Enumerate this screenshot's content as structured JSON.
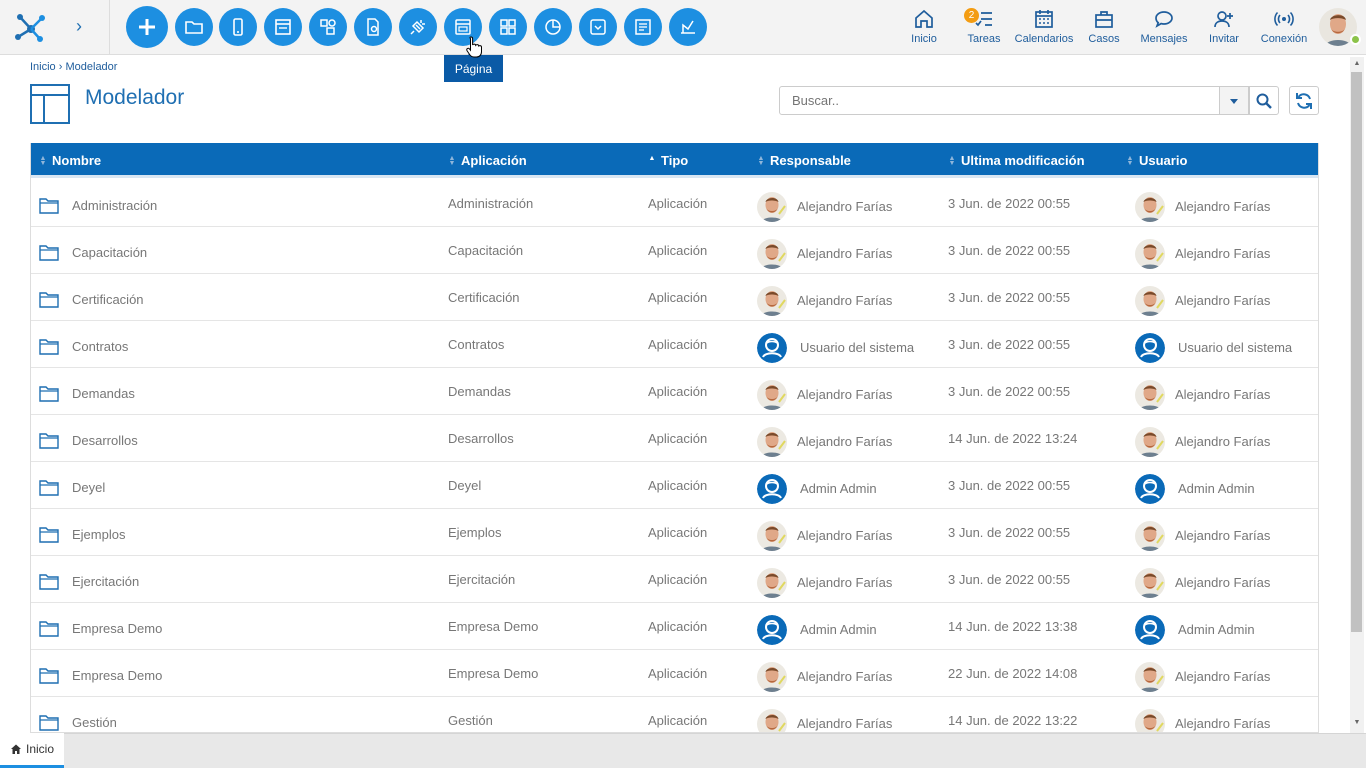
{
  "app": {
    "tooltip": "Página"
  },
  "nav": [
    {
      "label": "Inicio",
      "icon": "home-icon"
    },
    {
      "label": "Tareas",
      "icon": "tasks-icon",
      "badge": "2"
    },
    {
      "label": "Calendarios",
      "icon": "calendar-icon"
    },
    {
      "label": "Casos",
      "icon": "briefcase-icon"
    },
    {
      "label": "Mensajes",
      "icon": "chat-icon"
    },
    {
      "label": "Invitar",
      "icon": "invite-user-icon"
    },
    {
      "label": "Conexión",
      "icon": "connection-icon"
    }
  ],
  "breadcrumb": {
    "home": "Inicio",
    "separator": "›",
    "current": "Modelador"
  },
  "page": {
    "title": "Modelador"
  },
  "search": {
    "placeholder": "Buscar.."
  },
  "table": {
    "columns": [
      "Nombre",
      "Aplicación",
      "Tipo",
      "Responsable",
      "Ultima modificación",
      "Usuario"
    ],
    "rows": [
      {
        "nombre": "Administración",
        "aplicacion": "Administración",
        "tipo": "Aplicación",
        "responsable": "Alejandro Farías",
        "resp_avatar": "photo",
        "modificacion": "3 Jun. de 2022 00:55",
        "usuario": "Alejandro Farías",
        "user_avatar": "photo"
      },
      {
        "nombre": "Capacitación",
        "aplicacion": "Capacitación",
        "tipo": "Aplicación",
        "responsable": "Alejandro Farías",
        "resp_avatar": "photo",
        "modificacion": "3 Jun. de 2022 00:55",
        "usuario": "Alejandro Farías",
        "user_avatar": "photo"
      },
      {
        "nombre": "Certificación",
        "aplicacion": "Certificación",
        "tipo": "Aplicación",
        "responsable": "Alejandro Farías",
        "resp_avatar": "photo",
        "modificacion": "3 Jun. de 2022 00:55",
        "usuario": "Alejandro Farías",
        "user_avatar": "photo"
      },
      {
        "nombre": "Contratos",
        "aplicacion": "Contratos",
        "tipo": "Aplicación",
        "responsable": "Usuario del sistema",
        "resp_avatar": "system",
        "modificacion": "3 Jun. de 2022 00:55",
        "usuario": "Usuario del sistema",
        "user_avatar": "system"
      },
      {
        "nombre": "Demandas",
        "aplicacion": "Demandas",
        "tipo": "Aplicación",
        "responsable": "Alejandro Farías",
        "resp_avatar": "photo",
        "modificacion": "3 Jun. de 2022 00:55",
        "usuario": "Alejandro Farías",
        "user_avatar": "photo"
      },
      {
        "nombre": "Desarrollos",
        "aplicacion": "Desarrollos",
        "tipo": "Aplicación",
        "responsable": "Alejandro Farías",
        "resp_avatar": "photo",
        "modificacion": "14 Jun. de 2022 13:24",
        "usuario": "Alejandro Farías",
        "user_avatar": "photo"
      },
      {
        "nombre": "Deyel",
        "aplicacion": "Deyel",
        "tipo": "Aplicación",
        "responsable": "Admin Admin",
        "resp_avatar": "system",
        "modificacion": "3 Jun. de 2022 00:55",
        "usuario": "Admin Admin",
        "user_avatar": "system"
      },
      {
        "nombre": "Ejemplos",
        "aplicacion": "Ejemplos",
        "tipo": "Aplicación",
        "responsable": "Alejandro Farías",
        "resp_avatar": "photo",
        "modificacion": "3 Jun. de 2022 00:55",
        "usuario": "Alejandro Farías",
        "user_avatar": "photo"
      },
      {
        "nombre": "Ejercitación",
        "aplicacion": "Ejercitación",
        "tipo": "Aplicación",
        "responsable": "Alejandro Farías",
        "resp_avatar": "photo",
        "modificacion": "3 Jun. de 2022 00:55",
        "usuario": "Alejandro Farías",
        "user_avatar": "photo"
      },
      {
        "nombre": "Empresa Demo",
        "aplicacion": "Empresa Demo",
        "tipo": "Aplicación",
        "responsable": "Admin Admin",
        "resp_avatar": "system",
        "modificacion": "14 Jun. de 2022 13:38",
        "usuario": "Admin Admin",
        "user_avatar": "system"
      },
      {
        "nombre": "Empresa Demo",
        "aplicacion": "Empresa Demo",
        "tipo": "Aplicación",
        "responsable": "Alejandro Farías",
        "resp_avatar": "photo",
        "modificacion": "22 Jun. de 2022 14:08",
        "usuario": "Alejandro Farías",
        "user_avatar": "photo"
      },
      {
        "nombre": "Gestión",
        "aplicacion": "Gestión",
        "tipo": "Aplicación",
        "responsable": "Alejandro Farías",
        "resp_avatar": "photo",
        "modificacion": "14 Jun. de 2022 13:22",
        "usuario": "Alejandro Farías",
        "user_avatar": "photo"
      }
    ]
  },
  "bottom_tab": {
    "label": "Inicio"
  },
  "colors": {
    "primary": "#1d8fe1",
    "header": "#0a6ab8",
    "accent_badge": "#f39c12",
    "online": "#8cc34a"
  }
}
